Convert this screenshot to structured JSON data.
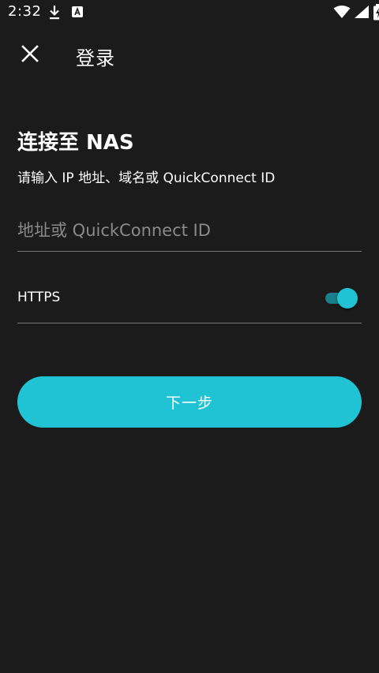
{
  "status_bar": {
    "time": "2:32",
    "icons": [
      "download-icon",
      "notification-a-icon",
      "wifi-icon",
      "cell-signal-icon",
      "battery-charging-icon"
    ]
  },
  "app_bar": {
    "close_icon": "close-icon",
    "title": "登录"
  },
  "main": {
    "heading": "连接至 NAS",
    "subheading": "请输入 IP 地址、域名或 QuickConnect ID",
    "address_input": {
      "placeholder": "地址或 QuickConnect ID",
      "value": ""
    },
    "https": {
      "label": "HTTPS",
      "enabled": true
    },
    "next_button_label": "下一步"
  },
  "colors": {
    "background": "#1b1b1b",
    "accent": "#1fc3d3",
    "divider": "#7a7a7a",
    "placeholder": "#8a8a8a"
  }
}
